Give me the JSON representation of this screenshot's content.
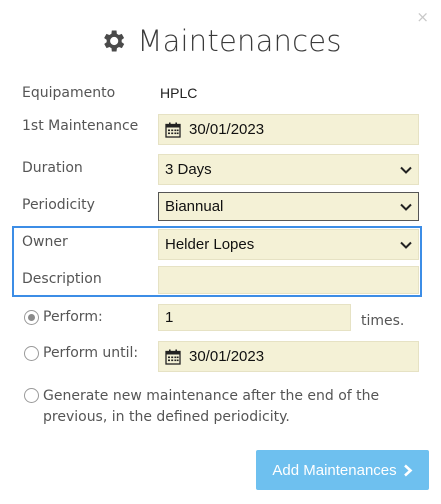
{
  "dialog": {
    "close_glyph": "×",
    "title": "Maintenances",
    "title_icon": "gear-icon"
  },
  "form": {
    "equipment": {
      "label": "Equipamento",
      "value": "HPLC"
    },
    "first_maintenance": {
      "label": "1st Maintenance",
      "value": "30/01/2023",
      "icon": "calendar-icon"
    },
    "duration": {
      "label": "Duration",
      "value": "3 Days"
    },
    "periodicity": {
      "label": "Periodicity",
      "value": "Biannual"
    },
    "owner": {
      "label": "Owner",
      "value": "Helder Lopes"
    },
    "description": {
      "label": "Description",
      "value": ""
    },
    "perform": {
      "label": "Perform:",
      "value": "1",
      "suffix": "times.",
      "checked": true
    },
    "perform_until": {
      "label": "Perform until:",
      "value": "30/01/2023",
      "checked": false
    },
    "generate_option": {
      "label": "Generate new maintenance after the end of the previous, in the defined periodicity.",
      "checked": false
    }
  },
  "actions": {
    "add_label": "Add Maintenances"
  },
  "colors": {
    "field_bg": "#f4f1d6",
    "highlight_border": "#3c8de6",
    "button_bg": "#6ec0ef"
  }
}
